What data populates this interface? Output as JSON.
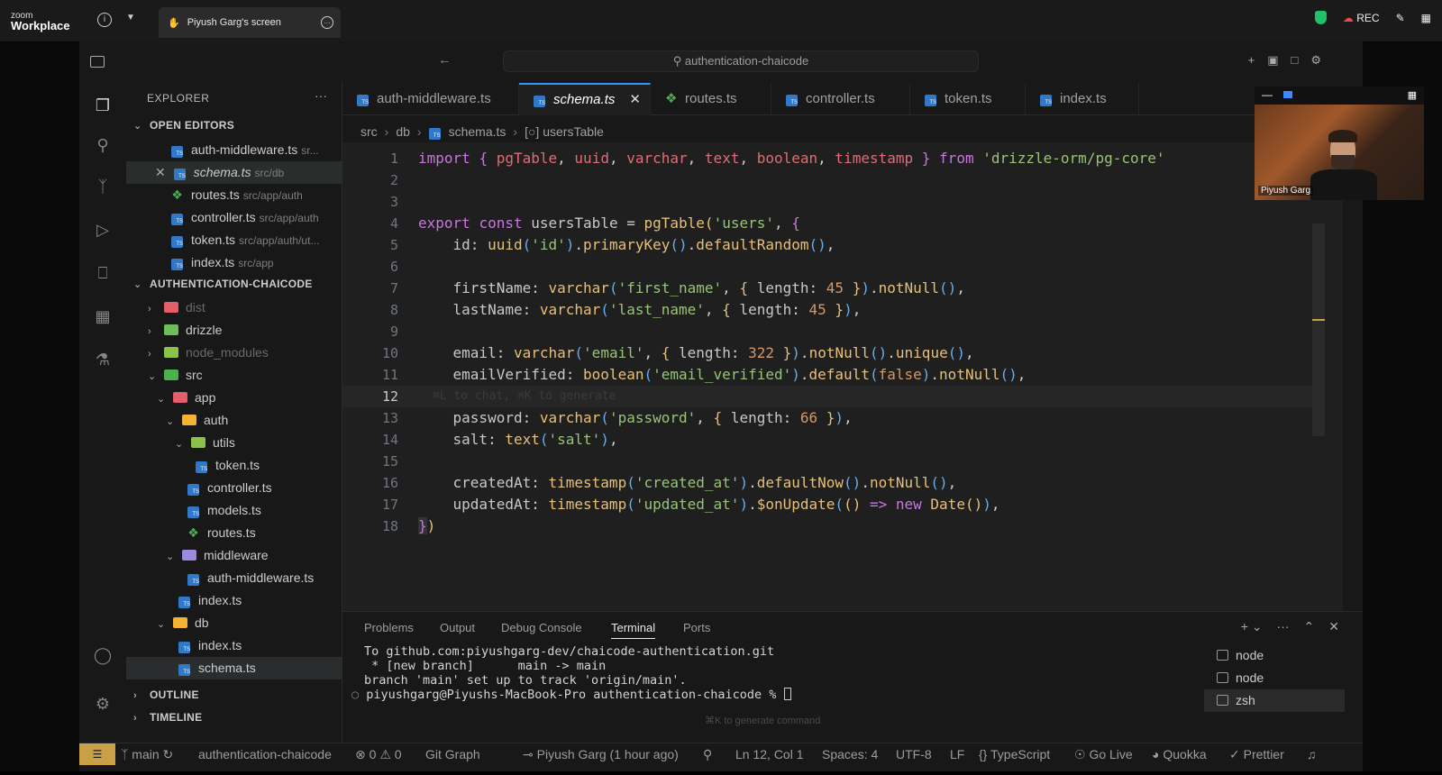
{
  "zoom": {
    "logo_line1": "zoom",
    "logo_line2": "Workplace",
    "screen_tab": "Piyush Garg's screen",
    "rec_label": "REC"
  },
  "vscode": {
    "command_center": "authentication-chaicode",
    "explorer": {
      "title": "EXPLORER",
      "open_editors_label": "OPEN EDITORS",
      "open_editors": [
        {
          "name": "auth-middleware.ts",
          "path": "sr..."
        },
        {
          "name": "schema.ts",
          "path": "src/db"
        },
        {
          "name": "routes.ts",
          "path": "src/app/auth"
        },
        {
          "name": "controller.ts",
          "path": "src/app/auth"
        },
        {
          "name": "token.ts",
          "path": "src/app/auth/ut..."
        },
        {
          "name": "index.ts",
          "path": "src/app"
        }
      ],
      "project_label": "AUTHENTICATION-CHAICODE",
      "tree": {
        "dist": "dist",
        "drizzle": "drizzle",
        "node_modules": "node_modules",
        "src": "src",
        "app": "app",
        "auth": "auth",
        "utils": "utils",
        "token": "token.ts",
        "controller": "controller.ts",
        "models": "models.ts",
        "routes": "routes.ts",
        "middleware": "middleware",
        "auth_middleware": "auth-middleware.ts",
        "app_index": "index.ts",
        "db": "db",
        "db_index": "index.ts",
        "schema": "schema.ts"
      },
      "outline_label": "OUTLINE",
      "timeline_label": "TIMELINE"
    },
    "tabs": [
      {
        "label": "auth-middleware.ts"
      },
      {
        "label": "schema.ts"
      },
      {
        "label": "routes.ts"
      },
      {
        "label": "controller.ts"
      },
      {
        "label": "token.ts"
      },
      {
        "label": "index.ts"
      }
    ],
    "breadcrumb": [
      "src",
      "db",
      "schema.ts",
      "usersTable"
    ],
    "code_line_numbers": [
      "1",
      "2",
      "3",
      "4",
      "5",
      "6",
      "7",
      "8",
      "9",
      "10",
      "11",
      "12",
      "13",
      "14",
      "15",
      "16",
      "17",
      "18"
    ],
    "inline_hint": "⌘L to chat, ⌘K to generate",
    "panel": {
      "tabs": [
        "Problems",
        "Output",
        "Debug Console",
        "Terminal",
        "Ports"
      ],
      "terminal_lines": [
        "To github.com:piyushgarg-dev/chaicode-authentication.git",
        " * [new branch]      main -> main",
        "branch 'main' set up to track 'origin/main'.",
        "piyushgarg@Piyushs-MacBook-Pro authentication-chaicode % "
      ],
      "terminal_hint": "⌘K to generate command",
      "terminals": [
        "node",
        "node",
        "zsh"
      ]
    },
    "statusbar": {
      "branch": "main",
      "project": "authentication-chaicode",
      "errors": "0",
      "warnings": "0",
      "git_graph": "Git Graph",
      "blame": "Piyush Garg (1 hour ago)",
      "position": "Ln 12, Col 1",
      "spaces": "Spaces: 4",
      "encoding": "UTF-8",
      "eol": "LF",
      "language": "TypeScript",
      "golive": "Go Live",
      "quokka": "Quokka",
      "prettier": "Prettier"
    }
  },
  "webcam": {
    "name": "Piyush Garg"
  },
  "colors": {
    "accent": "#3794ff",
    "remote": "#c9a046",
    "ts": "#3178c6"
  }
}
